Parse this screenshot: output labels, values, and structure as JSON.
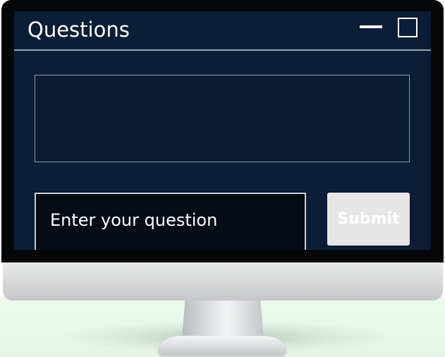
{
  "window": {
    "title": "Questions",
    "minimize_icon": "minimize-icon",
    "maximize_icon": "maximize-icon"
  },
  "output": {
    "text": ""
  },
  "question_input": {
    "value": "",
    "placeholder": "Enter your question"
  },
  "submit": {
    "label": "Submit"
  },
  "colors": {
    "window_background": "#0b1d37",
    "input_background": "#060b14",
    "submit_background": "#e6e6e6",
    "text": "#ffffff"
  }
}
